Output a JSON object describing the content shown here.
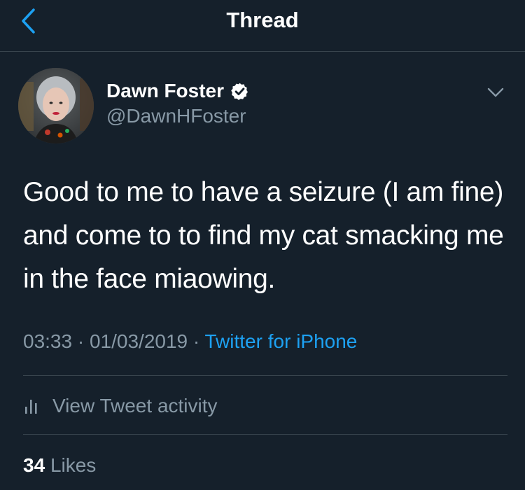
{
  "header": {
    "title": "Thread",
    "back_icon": "chevron-left-icon",
    "accent_color": "#1da1f2"
  },
  "tweet": {
    "author": {
      "display_name": "Dawn Foster",
      "handle": "@DawnHFoster",
      "verified": true,
      "verified_icon": "verified-badge-icon"
    },
    "text": "Good to me to have a seizure (I am fine) and come to to find my cat smacking me in the face miaowing.",
    "time": "03:33",
    "separator": " · ",
    "date": "01/03/2019",
    "source": "Twitter for iPhone",
    "more_icon": "chevron-down-icon"
  },
  "activity": {
    "label": "View Tweet activity",
    "icon": "bar-chart-icon"
  },
  "likes": {
    "count": "34",
    "label": "Likes"
  },
  "colors": {
    "background": "#15202b",
    "divider": "#38444d",
    "secondary_text": "#8899a6",
    "primary_text": "#ffffff",
    "link": "#1da1f2"
  }
}
